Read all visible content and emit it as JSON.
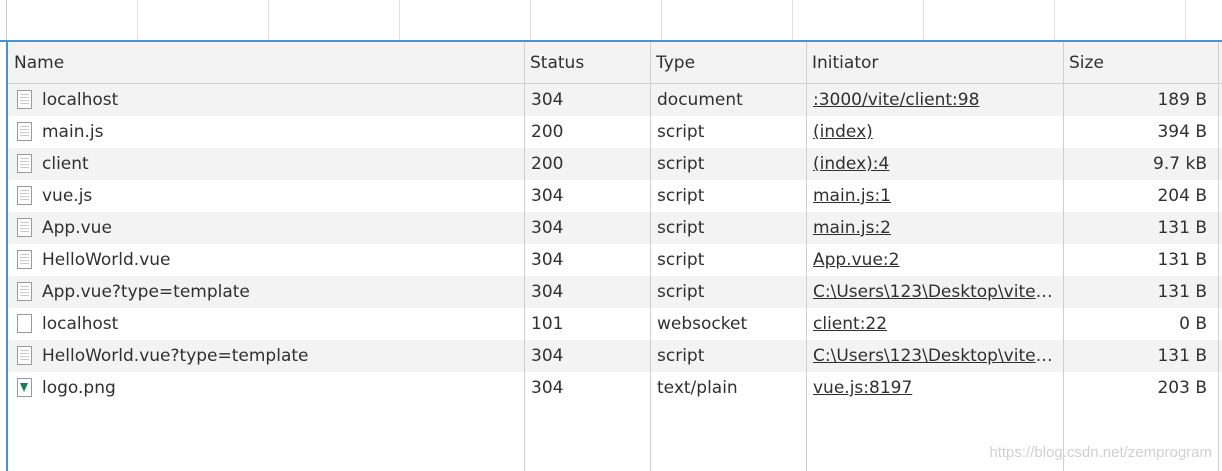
{
  "columns": {
    "name": "Name",
    "status": "Status",
    "type": "Type",
    "initiator": "Initiator",
    "size": "Size"
  },
  "rows": [
    {
      "name": "localhost",
      "status": "304",
      "type": "document",
      "initiator": ":3000/vite/client:98",
      "size": "189 B",
      "icon": "document-icon"
    },
    {
      "name": "main.js",
      "status": "200",
      "type": "script",
      "initiator": "(index)",
      "size": "394 B",
      "icon": "document-icon"
    },
    {
      "name": "client",
      "status": "200",
      "type": "script",
      "initiator": "(index):4",
      "size": "9.7 kB",
      "icon": "document-icon"
    },
    {
      "name": "vue.js",
      "status": "304",
      "type": "script",
      "initiator": "main.js:1",
      "size": "204 B",
      "icon": "document-icon"
    },
    {
      "name": "App.vue",
      "status": "304",
      "type": "script",
      "initiator": "main.js:2",
      "size": "131 B",
      "icon": "document-icon"
    },
    {
      "name": "HelloWorld.vue",
      "status": "304",
      "type": "script",
      "initiator": "App.vue:2",
      "size": "131 B",
      "icon": "document-icon"
    },
    {
      "name": "App.vue?type=template",
      "status": "304",
      "type": "script",
      "initiator": "C:\\Users\\123\\Desktop\\vite-t...",
      "size": "131 B",
      "icon": "document-icon"
    },
    {
      "name": "localhost",
      "status": "101",
      "type": "websocket",
      "initiator": "client:22",
      "size": "0 B",
      "icon": "blank-file-icon"
    },
    {
      "name": "HelloWorld.vue?type=template",
      "status": "304",
      "type": "script",
      "initiator": "C:\\Users\\123\\Desktop\\vite-t...",
      "size": "131 B",
      "icon": "document-icon"
    },
    {
      "name": "logo.png",
      "status": "304",
      "type": "text/plain",
      "initiator": "vue.js:8197",
      "size": "203 B",
      "icon": "image-icon"
    }
  ],
  "watermark": "https://blog.csdn.net/zemprogram",
  "colors": {
    "accent": "#4a90d9",
    "row_alt": "#f3f3f3",
    "header_bg": "#f3f3f3"
  }
}
